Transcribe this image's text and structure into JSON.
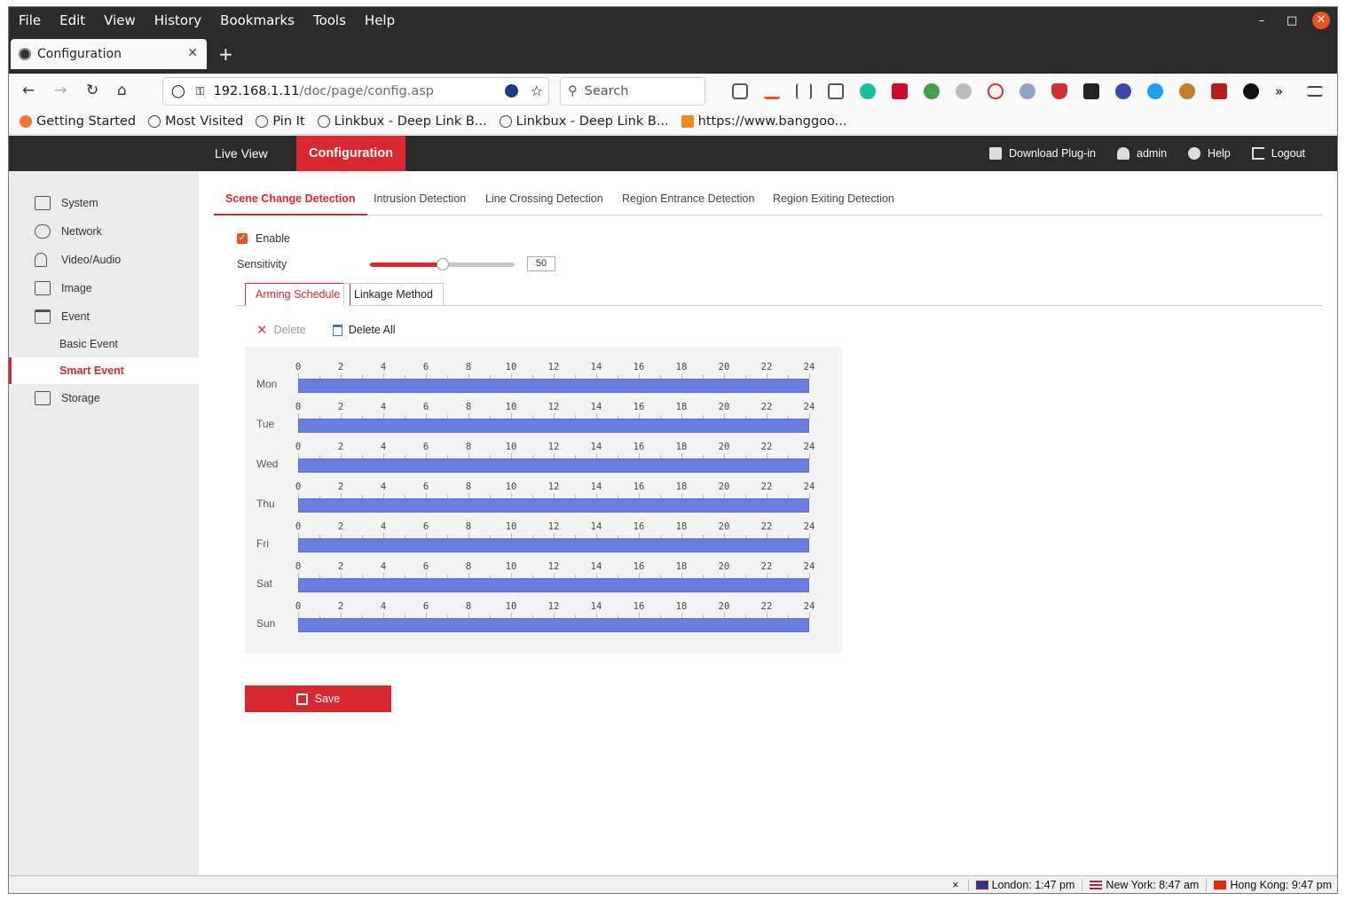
{
  "browser": {
    "menu": [
      "File",
      "Edit",
      "View",
      "History",
      "Bookmarks",
      "Tools",
      "Help"
    ],
    "tab_title": "Configuration",
    "url_host": "192.168.1.11",
    "url_path": "/doc/page/config.asp",
    "search_placeholder": "Search",
    "bookmarks": [
      "Getting Started",
      "Most Visited",
      "Pin It",
      "Linkbux - Deep Link B...",
      "Linkbux - Deep Link B...",
      "https://www.banggoo..."
    ]
  },
  "app": {
    "nav_live_view": "Live View",
    "nav_configuration": "Configuration",
    "download_plugin": "Download Plug-in",
    "user": "admin",
    "help": "Help",
    "logout": "Logout"
  },
  "sidebar": {
    "items": [
      {
        "label": "System"
      },
      {
        "label": "Network"
      },
      {
        "label": "Video/Audio"
      },
      {
        "label": "Image"
      },
      {
        "label": "Event"
      },
      {
        "label": "Basic Event"
      },
      {
        "label": "Smart Event"
      },
      {
        "label": "Storage"
      }
    ]
  },
  "main": {
    "tabs": [
      "Scene Change Detection",
      "Intrusion Detection",
      "Line Crossing Detection",
      "Region Entrance Detection",
      "Region Exiting Detection"
    ],
    "enable_label": "Enable",
    "enable_checked": true,
    "sensitivity_label": "Sensitivity",
    "sensitivity_value": "50",
    "panel_tabs": [
      "Arming Schedule",
      "Linkage Method"
    ],
    "delete_label": "Delete",
    "delete_all_label": "Delete All",
    "save_label": "Save"
  },
  "schedule": {
    "hour_ticks": [
      "0",
      "2",
      "4",
      "6",
      "8",
      "10",
      "12",
      "14",
      "16",
      "18",
      "20",
      "22",
      "24"
    ],
    "days": [
      {
        "day": "Mon",
        "start": 0,
        "end": 24
      },
      {
        "day": "Tue",
        "start": 0,
        "end": 24
      },
      {
        "day": "Wed",
        "start": 0,
        "end": 24
      },
      {
        "day": "Thu",
        "start": 0,
        "end": 24
      },
      {
        "day": "Fri",
        "start": 0,
        "end": 24
      },
      {
        "day": "Sat",
        "start": 0,
        "end": 24
      },
      {
        "day": "Sun",
        "start": 0,
        "end": 24
      }
    ],
    "bar_color": "#6b7fe0"
  },
  "statusbar": {
    "london": "London: 1:47 pm",
    "new_york": "New York: 8:47 am",
    "hong_kong": "Hong Kong: 9:47 pm"
  },
  "colors": {
    "accent": "#d9282f",
    "header_bg": "#2b2b2b"
  }
}
